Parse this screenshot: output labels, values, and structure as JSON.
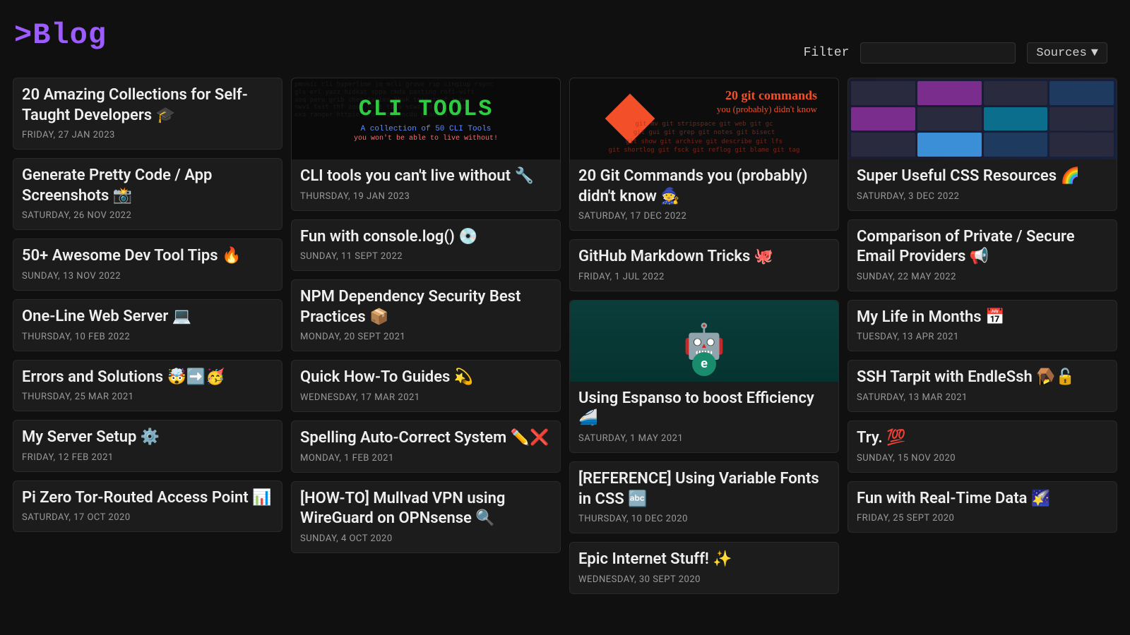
{
  "header": {
    "title_prompt": ">",
    "title_text": "Blog",
    "filter_label": "Filter",
    "sources_label": "Sources"
  },
  "columns": [
    [
      {
        "title": "20 Amazing Collections for Self-Taught Developers 🎓",
        "date": "FRIDAY, 27 JAN 2023"
      },
      {
        "title": "Generate Pretty Code / App Screenshots 📸",
        "date": "SATURDAY, 26 NOV 2022"
      },
      {
        "title": "50+ Awesome Dev Tool Tips 🔥",
        "date": "SUNDAY, 13 NOV 2022"
      },
      {
        "title": "One-Line Web Server 💻",
        "date": "THURSDAY, 10 FEB 2022"
      },
      {
        "title": "Errors and Solutions 🤯➡️🥳",
        "date": "THURSDAY, 25 MAR 2021"
      },
      {
        "title": "My Server Setup ⚙️",
        "date": "FRIDAY, 12 FEB 2021"
      },
      {
        "title": "Pi Zero Tor-Routed Access Point 📊",
        "date": "SATURDAY, 17 OCT 2020"
      }
    ],
    [
      {
        "title": "CLI tools you can't live without 🔧",
        "date": "THURSDAY, 19 JAN 2023",
        "thumb": "cli",
        "thumb_text": {
          "t1": "CLI TOOLS",
          "t2": "A collection of 50 CLI Tools",
          "t3": "you won't be able to live without!"
        }
      },
      {
        "title": "Fun with console.log() 💿",
        "date": "SUNDAY, 11 SEPT 2022"
      },
      {
        "title": "NPM Dependency Security Best Practices 📦",
        "date": "MONDAY, 20 SEPT 2021"
      },
      {
        "title": "Quick How-To Guides 💫",
        "date": "WEDNESDAY, 17 MAR 2021"
      },
      {
        "title": "Spelling Auto-Correct System ✏️❌",
        "date": "MONDAY, 1 FEB 2021"
      },
      {
        "title": "[HOW-TO] Mullvad VPN using WireGuard on OPNsense 🔍",
        "date": "SUNDAY, 4 OCT 2020"
      }
    ],
    [
      {
        "title": "20 Git Commands you (probably) didn't know 🧙",
        "date": "SATURDAY, 17 DEC 2022",
        "thumb": "git",
        "thumb_text": {
          "t1": "20 git commands",
          "t2": "you (probably) didn't know",
          "cmds": "git mv  git stripspace  git web  git gc\ngit gui  git grep  git notes  git bisect\ngit show  git archive  git describe  git lfs\ngit shortlog  git fsck  git reflog  git blame  git tag"
        }
      },
      {
        "title": "GitHub Markdown Tricks 🐙",
        "date": "FRIDAY, 1 JUL 2022"
      },
      {
        "title": "Using Espanso to boost Efficiency 🚄",
        "date": "SATURDAY, 1 MAY 2021",
        "thumb": "espanso"
      },
      {
        "title": "[REFERENCE] Using Variable Fonts in CSS 🔤",
        "date": "THURSDAY, 10 DEC 2020"
      },
      {
        "title": "Epic Internet Stuff! ✨",
        "date": "WEDNESDAY, 30 SEPT 2020"
      }
    ],
    [
      {
        "title": "Super Useful CSS Resources 🌈",
        "date": "SATURDAY, 3 DEC 2022",
        "thumb": "css"
      },
      {
        "title": "Comparison of Private / Secure Email Providers 📢",
        "date": "SUNDAY, 22 MAY 2022"
      },
      {
        "title": "My Life in Months 📅",
        "date": "TUESDAY, 13 APR 2021"
      },
      {
        "title": "SSH Tarpit with EndleSsh 🪤🔓",
        "date": "SATURDAY, 13 MAR 2021"
      },
      {
        "title": "Try. 💯",
        "date": "SUNDAY, 15 NOV 2020"
      },
      {
        "title": "Fun with Real-Time Data 🌠",
        "date": "FRIDAY, 25 SEPT 2020"
      }
    ]
  ]
}
